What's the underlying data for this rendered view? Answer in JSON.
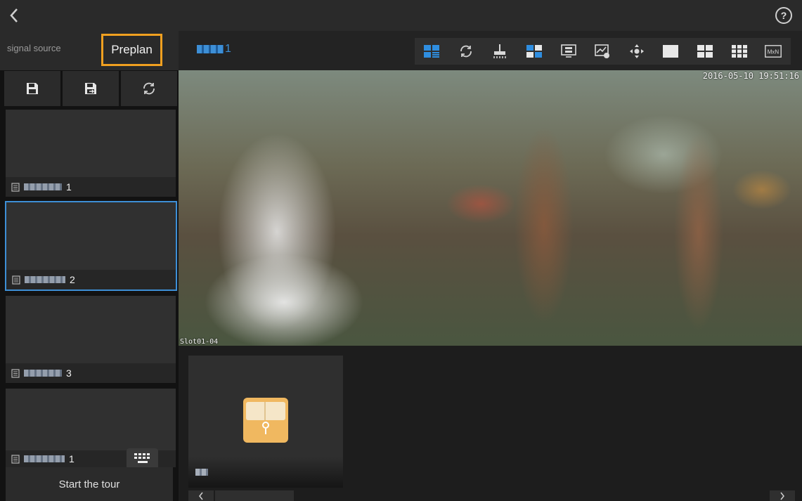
{
  "topbar": {
    "help_label": "?"
  },
  "tabs": {
    "signal_source": "signal source",
    "preplan": "Preplan"
  },
  "plans": [
    {
      "suffix": "1",
      "selected": false
    },
    {
      "suffix": "2",
      "selected": true
    },
    {
      "suffix": "3",
      "selected": false
    },
    {
      "suffix": "1",
      "selected": false
    }
  ],
  "tour": {
    "label": "Start the tour"
  },
  "wall": {
    "name_suffix": "1"
  },
  "toolbar": {
    "icons": [
      "layout-list-icon",
      "refresh-icon",
      "clear-wall-icon",
      "window-split-icon",
      "screen-settings-icon",
      "monitor-icon",
      "ptz-control-icon",
      "single-window-icon",
      "four-window-icon",
      "nine-window-icon",
      "custom-split-icon"
    ],
    "mxn_label": "MxN"
  },
  "video": {
    "timestamp": "2016-05-10 19:51:16",
    "slot_label": "Slot01-04"
  },
  "colors": {
    "accent_orange": "#f0a020",
    "accent_blue": "#3d8fd6"
  }
}
